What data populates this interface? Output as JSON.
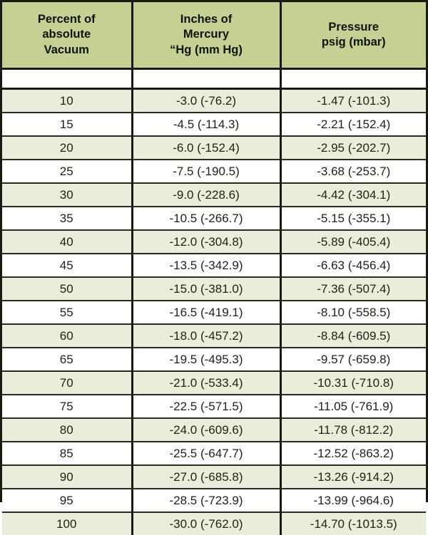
{
  "table": {
    "name": "vacuum-conversion-table",
    "columns": [
      {
        "id": "percent-vacuum",
        "lines": [
          "Percent of",
          "absolute",
          "Vacuum"
        ]
      },
      {
        "id": "inches-mercury",
        "lines": [
          "Inches of",
          "Mercury",
          "“Hg (mm Hg)"
        ]
      },
      {
        "id": "pressure-psig",
        "lines": [
          "Pressure",
          "psig (mbar)"
        ]
      }
    ],
    "blank_row": {
      "present": true,
      "cells": [
        "",
        "",
        ""
      ]
    },
    "rows": [
      {
        "percent": "10",
        "inches_hg": "-3.0 (-76.2)",
        "pressure": "-1.47 (-101.3)"
      },
      {
        "percent": "15",
        "inches_hg": "-4.5 (-114.3)",
        "pressure": "-2.21 (-152.4)"
      },
      {
        "percent": "20",
        "inches_hg": "-6.0 (-152.4)",
        "pressure": "-2.95 (-202.7)"
      },
      {
        "percent": "25",
        "inches_hg": "-7.5 (-190.5)",
        "pressure": "-3.68 (-253.7)"
      },
      {
        "percent": "30",
        "inches_hg": "-9.0 (-228.6)",
        "pressure": "-4.42 (-304.1)"
      },
      {
        "percent": "35",
        "inches_hg": "-10.5 (-266.7)",
        "pressure": "-5.15 (-355.1)"
      },
      {
        "percent": "40",
        "inches_hg": "-12.0 (-304.8)",
        "pressure": "-5.89 (-405.4)"
      },
      {
        "percent": "45",
        "inches_hg": "-13.5 (-342.9)",
        "pressure": "-6.63 (-456.4)"
      },
      {
        "percent": "50",
        "inches_hg": "-15.0 (-381.0)",
        "pressure": "-7.36 (-507.4)"
      },
      {
        "percent": "55",
        "inches_hg": "-16.5 (-419.1)",
        "pressure": "-8.10 (-558.5)"
      },
      {
        "percent": "60",
        "inches_hg": "-18.0 (-457.2)",
        "pressure": "-8.84 (-609.5)"
      },
      {
        "percent": "65",
        "inches_hg": "-19.5 (-495.3)",
        "pressure": "-9.57 (-659.8)"
      },
      {
        "percent": "70",
        "inches_hg": "-21.0 (-533.4)",
        "pressure": "-10.31 (-710.8)"
      },
      {
        "percent": "75",
        "inches_hg": "-22.5 (-571.5)",
        "pressure": "-11.05 (-761.9)"
      },
      {
        "percent": "80",
        "inches_hg": "-24.0 (-609.6)",
        "pressure": "-11.78 (-812.2)"
      },
      {
        "percent": "85",
        "inches_hg": "-25.5 (-647.7)",
        "pressure": "-12.52 (-863.2)"
      },
      {
        "percent": "90",
        "inches_hg": "-27.0 (-685.8)",
        "pressure": "-13.26 (-914.2)"
      },
      {
        "percent": "95",
        "inches_hg": "-28.5 (-723.9)",
        "pressure": "-13.99 (-964.6)"
      },
      {
        "percent": "100",
        "inches_hg": "-30.0 (-762.0)",
        "pressure": "-14.70 (-1013.5)"
      }
    ]
  },
  "colors": {
    "header_background": "#c4d193",
    "row_tint": "#e9eeda",
    "row_plain": "#ffffff",
    "border": "#1a1a12",
    "text": "#222218"
  },
  "chart_data": {
    "type": "table",
    "title": "",
    "categories": [
      "Percent of absolute Vacuum",
      "Inches of Mercury “Hg (mm Hg)",
      "Pressure psig (mbar)"
    ],
    "x": [
      10,
      15,
      20,
      25,
      30,
      35,
      40,
      45,
      50,
      55,
      60,
      65,
      70,
      75,
      80,
      85,
      90,
      95,
      100
    ],
    "xlabel": "Percent of absolute Vacuum",
    "ylabel": "",
    "series": [
      {
        "name": "Inches of Mercury (“Hg)",
        "values": [
          -3.0,
          -4.5,
          -6.0,
          -7.5,
          -9.0,
          -10.5,
          -12.0,
          -13.5,
          -15.0,
          -16.5,
          -18.0,
          -19.5,
          -21.0,
          -22.5,
          -24.0,
          -25.5,
          -27.0,
          -28.5,
          -30.0
        ]
      },
      {
        "name": "Millimeters of Mercury (mm Hg)",
        "values": [
          -76.2,
          -114.3,
          -152.4,
          -190.5,
          -228.6,
          -266.7,
          -304.8,
          -342.9,
          -381.0,
          -419.1,
          -457.2,
          -495.3,
          -533.4,
          -571.5,
          -609.6,
          -647.7,
          -685.8,
          -723.9,
          -762.0
        ]
      },
      {
        "name": "Pressure (psig)",
        "values": [
          -1.47,
          -2.21,
          -2.95,
          -3.68,
          -4.42,
          -5.15,
          -5.89,
          -6.63,
          -7.36,
          -8.1,
          -8.84,
          -9.57,
          -10.31,
          -11.05,
          -11.78,
          -12.52,
          -13.26,
          -13.99,
          -14.7
        ]
      },
      {
        "name": "Pressure (mbar)",
        "values": [
          -101.3,
          -152.4,
          -202.7,
          -253.7,
          -304.1,
          -355.1,
          -405.4,
          -456.4,
          -507.4,
          -558.5,
          -609.5,
          -659.8,
          -710.8,
          -761.9,
          -812.2,
          -863.2,
          -914.2,
          -964.6,
          -1013.5
        ]
      }
    ]
  }
}
